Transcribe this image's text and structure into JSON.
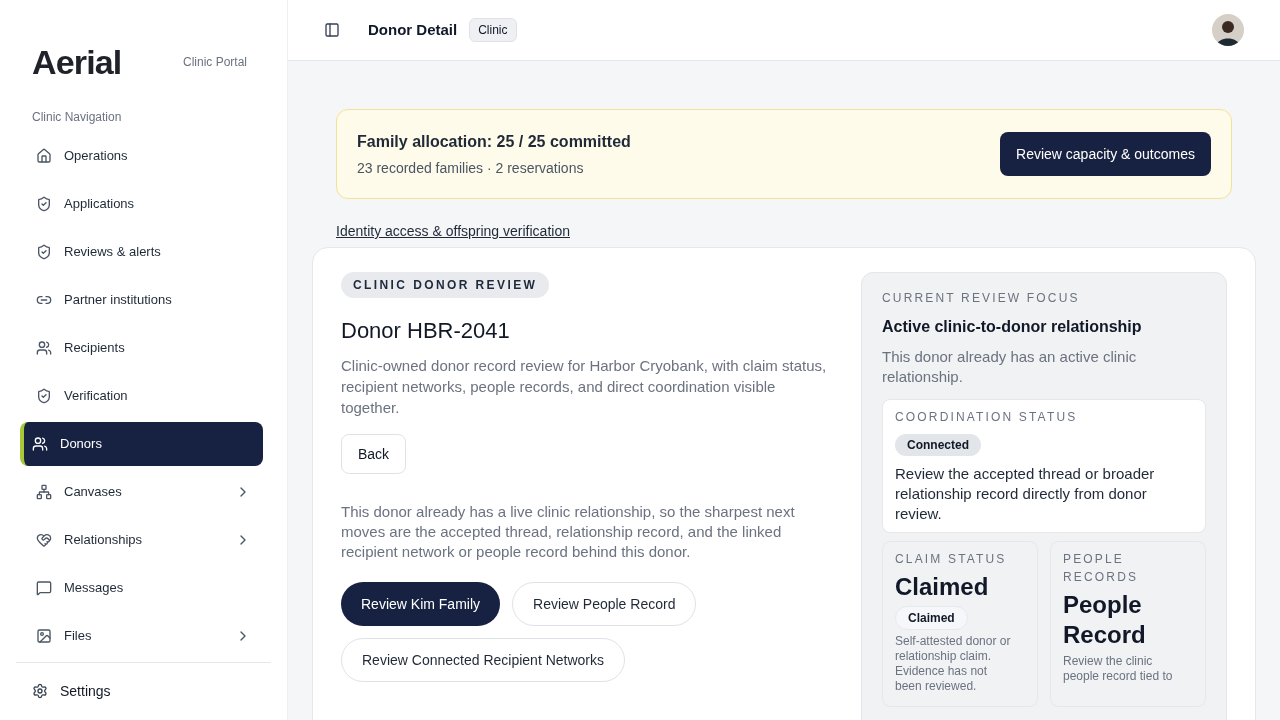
{
  "sidebar": {
    "logo": "Aerial",
    "portal": "Clinic Portal",
    "section": "Clinic Navigation",
    "items": [
      {
        "label": "Operations",
        "selected": false,
        "expandable": false
      },
      {
        "label": "Applications",
        "selected": false,
        "expandable": false
      },
      {
        "label": "Reviews & alerts",
        "selected": false,
        "expandable": false
      },
      {
        "label": "Partner institutions",
        "selected": false,
        "expandable": false
      },
      {
        "label": "Recipients",
        "selected": false,
        "expandable": false
      },
      {
        "label": "Verification",
        "selected": false,
        "expandable": false
      },
      {
        "label": "Donors",
        "selected": true,
        "expandable": false
      },
      {
        "label": "Canvases",
        "selected": false,
        "expandable": true
      },
      {
        "label": "Relationships",
        "selected": false,
        "expandable": true
      },
      {
        "label": "Messages",
        "selected": false,
        "expandable": false
      },
      {
        "label": "Files",
        "selected": false,
        "expandable": true
      }
    ],
    "settings": "Settings"
  },
  "header": {
    "title": "Donor Detail",
    "badge": "Clinic"
  },
  "banner": {
    "title": "Family allocation: 25 / 25 committed",
    "subtitle": "23 recorded families · 2 reservations",
    "button": "Review capacity & outcomes"
  },
  "link": "Identity access & offspring verification",
  "review": {
    "eyebrow": "CLINIC DONOR REVIEW",
    "title": "Donor HBR-2041",
    "description": "Clinic-owned donor record review for Harbor Cryobank, with claim status, recipient networks, people records, and direct coordination visible together.",
    "back": "Back",
    "note": "This donor already has a live clinic relationship, so the sharpest next moves are the accepted thread, relationship record, and the linked recipient network or people record behind this donor.",
    "actions": [
      {
        "label": "Review Kim Family",
        "primary": true
      },
      {
        "label": "Review People Record",
        "primary": false
      },
      {
        "label": "Review Connected Recipient Networks",
        "primary": false
      }
    ]
  },
  "focus": {
    "eyebrow": "CURRENT REVIEW FOCUS",
    "title": "Active clinic-to-donor relationship",
    "description": "This donor already has an active clinic relationship.",
    "coordination": {
      "eyebrow": "COORDINATION STATUS",
      "badge": "Connected",
      "text": "Review the accepted thread or broader relationship record directly from donor review."
    },
    "tiles": [
      {
        "eyebrow": "CLAIM STATUS",
        "title": "Claimed",
        "badge": "Claimed",
        "text": "Self-attested donor or relationship claim. Evidence has not been reviewed."
      },
      {
        "eyebrow": "PEOPLE RECORDS",
        "title": "People Record",
        "text": "Review the clinic people record tied to"
      }
    ]
  }
}
